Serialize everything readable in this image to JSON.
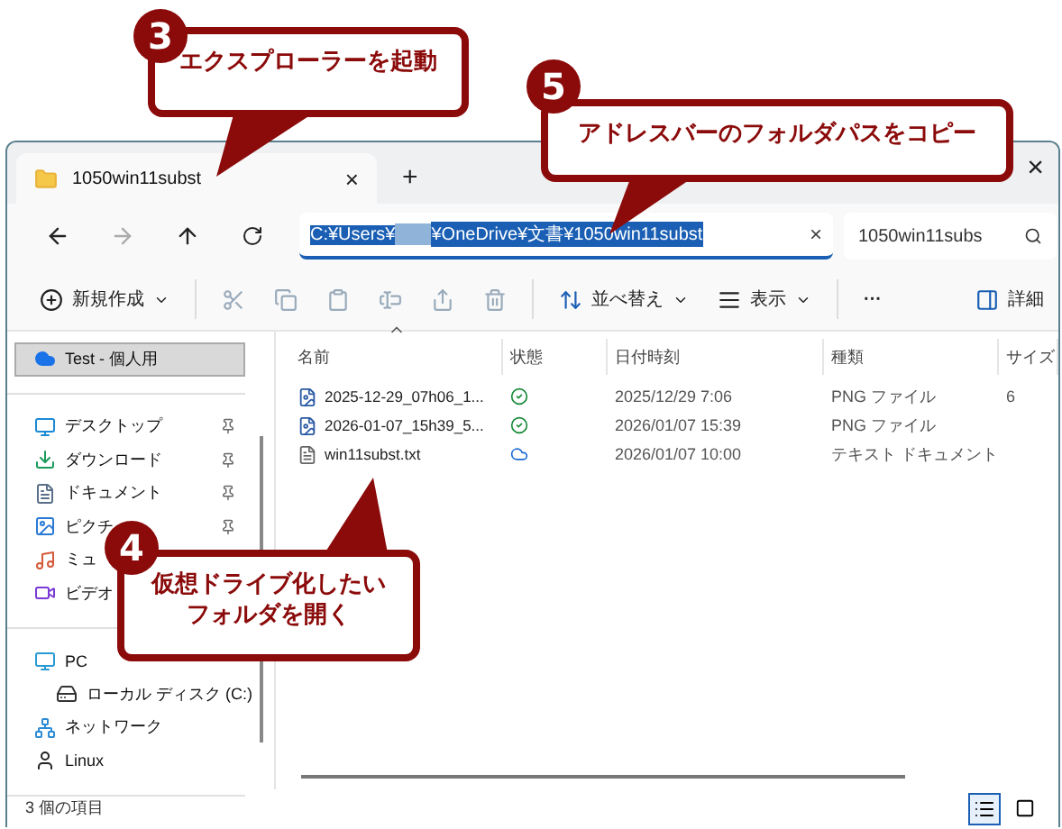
{
  "window": {
    "tab": {
      "title": "1050win11subst",
      "close": "×"
    },
    "new_tab": "+",
    "close": "×"
  },
  "address_bar": {
    "path_before": "C:¥Users¥",
    "path_after": "¥OneDrive¥文書¥1050win11subst",
    "selected": true,
    "clear": "×"
  },
  "search": {
    "value": "1050win11subs"
  },
  "toolbar": {
    "new": "新規作成",
    "sort": "並べ替え",
    "view": "表示",
    "more": "···",
    "details": "詳細"
  },
  "sidebar": {
    "sections": [
      {
        "items": [
          {
            "label": "Test - 個人用",
            "kind": "cloud",
            "selected": true,
            "pinned": false
          }
        ]
      },
      {
        "items": [
          {
            "label": "デスクトップ",
            "kind": "desktop",
            "selected": false,
            "pinned": true
          },
          {
            "label": "ダウンロード",
            "kind": "download",
            "selected": false,
            "pinned": true
          },
          {
            "label": "ドキュメント",
            "kind": "document",
            "selected": false,
            "pinned": true
          },
          {
            "label": "ピクチ",
            "kind": "picture",
            "selected": false,
            "pinned": true
          },
          {
            "label": "ミュ",
            "kind": "music",
            "selected": false,
            "pinned": false
          },
          {
            "label": "ビデオ",
            "kind": "video",
            "selected": false,
            "pinned": false
          }
        ]
      },
      {
        "items": [
          {
            "label": "PC",
            "kind": "pc",
            "selected": false,
            "pinned": false,
            "children": [
              {
                "label": "ローカル ディスク (C:)",
                "kind": "disk",
                "selected": false,
                "pinned": false
              }
            ]
          },
          {
            "label": "ネットワーク",
            "kind": "network",
            "selected": false,
            "pinned": false
          },
          {
            "label": "Linux",
            "kind": "linux",
            "selected": false,
            "pinned": false
          }
        ]
      }
    ]
  },
  "table": {
    "columns": [
      "名前",
      "状態",
      "日付時刻",
      "種類",
      "サイズ"
    ],
    "rows": [
      {
        "name": "2025-12-29_07h06_1...",
        "kind": "image",
        "synced": true,
        "date": "2025/12/29 7:06",
        "type": "PNG ファイル",
        "size": "6"
      },
      {
        "name": "2026-01-07_15h39_5...",
        "kind": "image",
        "synced": true,
        "date": "2026/01/07 15:39",
        "type": "PNG ファイル"
      },
      {
        "name": "win11subst.txt",
        "kind": "text",
        "synced": false,
        "date": "2026/01/07 10:00",
        "type": "テキスト ドキュメント"
      }
    ]
  },
  "status_bar": {
    "count": "3 個の項目",
    "details_view": true
  },
  "callouts": [
    {
      "number": "3",
      "text": "エクスプローラーを起動"
    },
    {
      "number": "5",
      "text": "アドレスバーのフォルダパスをコピー"
    },
    {
      "number": "4",
      "text": "仮想ドライブ化したいフォルダを開く"
    }
  ]
}
